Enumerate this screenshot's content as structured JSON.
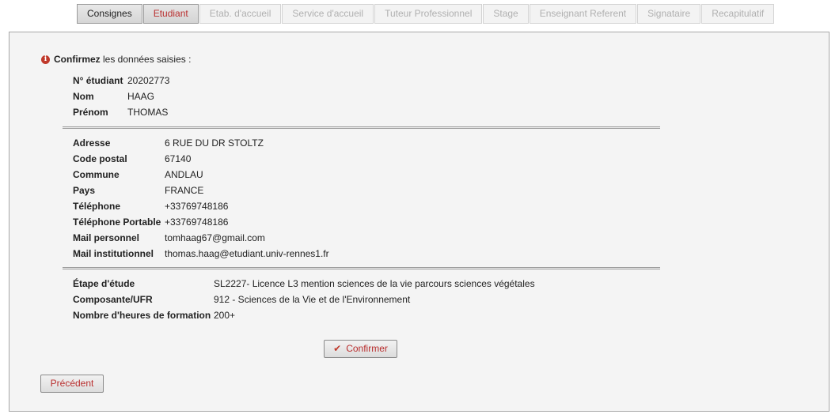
{
  "tabs": [
    {
      "label": "Consignes",
      "state": "visited"
    },
    {
      "label": "Etudiant",
      "state": "active"
    },
    {
      "label": "Etab. d'accueil",
      "state": "disabled"
    },
    {
      "label": "Service d'accueil",
      "state": "disabled"
    },
    {
      "label": "Tuteur Professionnel",
      "state": "disabled"
    },
    {
      "label": "Stage",
      "state": "disabled"
    },
    {
      "label": "Enseignant Referent",
      "state": "disabled"
    },
    {
      "label": "Signataire",
      "state": "disabled"
    },
    {
      "label": "Recapitulatif",
      "state": "disabled"
    }
  ],
  "intro": {
    "icon": "info-circle-icon",
    "strong": "Confirmez",
    "rest": " les données saisies :"
  },
  "identity": [
    {
      "label": "N° étudiant",
      "value": "20202773"
    },
    {
      "label": "Nom",
      "value": "HAAG"
    },
    {
      "label": "Prénom",
      "value": "THOMAS"
    }
  ],
  "contact": [
    {
      "label": "Adresse",
      "value": "6 RUE DU DR STOLTZ"
    },
    {
      "label": "Code postal",
      "value": "67140"
    },
    {
      "label": "Commune",
      "value": "ANDLAU"
    },
    {
      "label": "Pays",
      "value": "FRANCE"
    },
    {
      "label": "Téléphone",
      "value": "+33769748186"
    },
    {
      "label": "Téléphone Portable",
      "value": "+33769748186"
    },
    {
      "label": "Mail personnel",
      "value": "tomhaag67@gmail.com"
    },
    {
      "label": "Mail institutionnel",
      "value": "thomas.haag@etudiant.univ-rennes1.fr"
    }
  ],
  "studies": [
    {
      "label": "Étape d'étude",
      "value": "SL2227- Licence L3 mention sciences de la vie parcours sciences végétales"
    },
    {
      "label": "Composante/UFR",
      "value": "912 - Sciences de la Vie et de l'Environnement"
    },
    {
      "label": "Nombre d'heures de formation",
      "value": "200+"
    }
  ],
  "buttons": {
    "confirm": "Confirmer",
    "confirm_icon": "check-icon",
    "previous": "Précédent"
  },
  "colors": {
    "accent": "#b92e2e",
    "panel_bg": "#f4f4f4"
  }
}
